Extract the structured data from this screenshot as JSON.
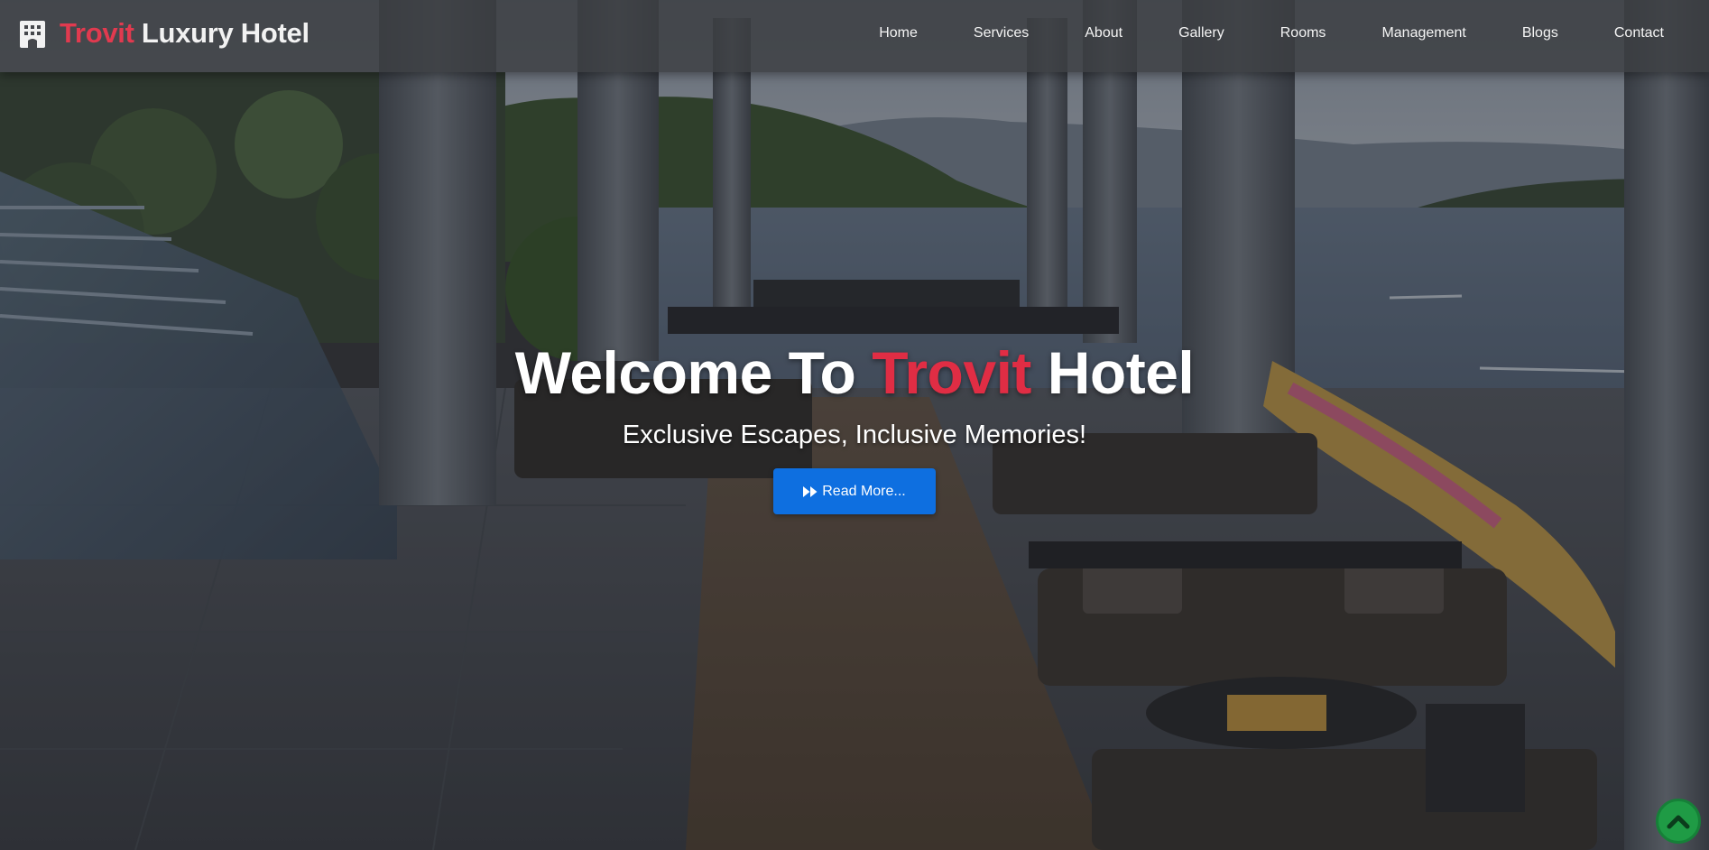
{
  "brand": {
    "accent": "Trovit",
    "rest": " Luxury Hotel",
    "icon": "hotel-building-icon"
  },
  "nav": {
    "items": [
      {
        "label": "Home"
      },
      {
        "label": "Services"
      },
      {
        "label": "About"
      },
      {
        "label": "Gallery"
      },
      {
        "label": "Rooms"
      },
      {
        "label": "Management"
      },
      {
        "label": "Blogs"
      },
      {
        "label": "Contact"
      }
    ]
  },
  "hero": {
    "title_prefix": "Welcome To ",
    "title_accent": "Trovit",
    "title_suffix": " Hotel",
    "subtitle": "Exclusive Escapes, Inclusive Memories!",
    "button_label": "Read More...",
    "button_icon": "fast-forward-icon"
  },
  "back_to_top": {
    "icon": "chevron-up-icon"
  },
  "colors": {
    "accent_red": "#e13a4f",
    "button_blue": "#0e6fe0",
    "back_to_top_green": "#1f9b45",
    "navbar_bg": "#3c3e42"
  }
}
